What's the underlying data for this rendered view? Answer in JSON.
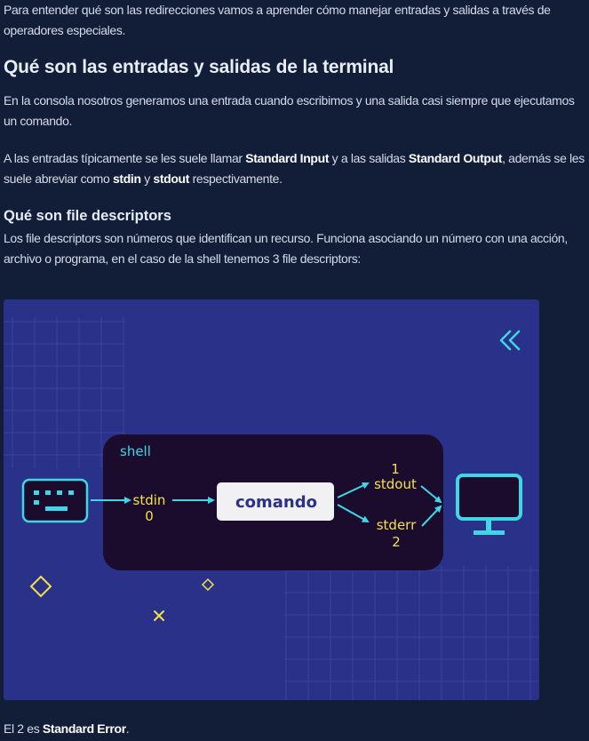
{
  "intro": {
    "text": "Para entender qué son las redirecciones vamos a aprender cómo manejar entradas y salidas a través de operadores especiales."
  },
  "section1": {
    "heading": "Qué son las entradas y salidas de la terminal",
    "p1": "En la consola nosotros generamos una entrada cuando escribimos y una salida casi siempre que ejecutamos un comando.",
    "p2_a": "A las entradas típicamente se les suele llamar ",
    "p2_b": "Standard Input",
    "p2_c": " y a las salidas ",
    "p2_d": "Standard Output",
    "p2_e": ", además se les suele abreviar como ",
    "p2_f": "stdin",
    "p2_g": " y ",
    "p2_h": "stdout",
    "p2_i": " respectivamente."
  },
  "section2": {
    "heading": "Qué son file descriptors",
    "p1": "Los file descriptors son números que identifican un recurso. Funciona asociando un número con una acción, archivo o programa, en el caso de la shell tenemos 3 file descriptors:"
  },
  "diagram": {
    "shell_label": "shell",
    "stdin_label": "stdin",
    "stdin_num": "0",
    "command_label": "comando",
    "stdout_num": "1",
    "stdout_label": "stdout",
    "stderr_label": "stderr",
    "stderr_num": "2",
    "colors": {
      "background": "#2a3188",
      "shell_box": "#1b0c2d",
      "accent_cyan": "#3fd6e6",
      "accent_yellow": "#f2e24a",
      "command_box": "#f1f1f3",
      "command_text": "#2a3188"
    },
    "icons": [
      "keyboard-icon",
      "monitor-icon",
      "double-chevron-left-icon",
      "diamond-icon",
      "cross-icon"
    ]
  },
  "footer": {
    "text_a": "El 2 es ",
    "text_b": "Standard Error",
    "text_c": "."
  }
}
